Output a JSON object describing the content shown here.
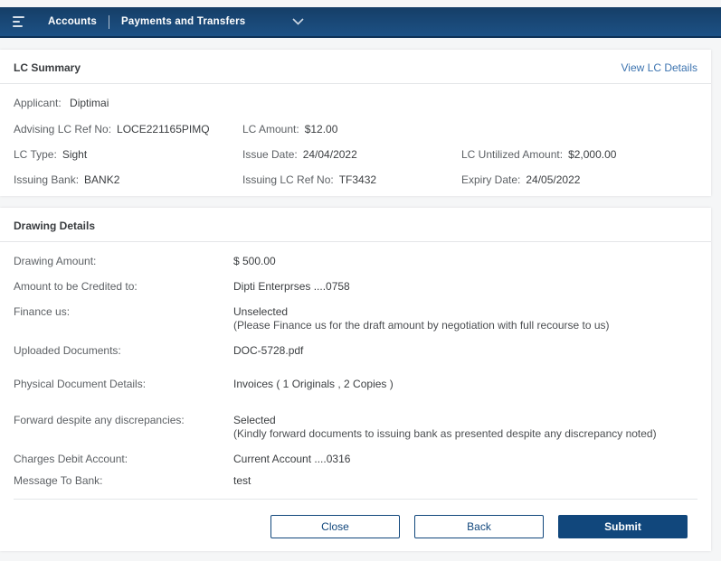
{
  "nav": {
    "accounts_label": "Accounts",
    "payments_label": "Payments and Transfers"
  },
  "lc_summary": {
    "title": "LC Summary",
    "view_details_label": "View LC Details",
    "applicant": {
      "label": "Applicant:",
      "value": "Diptimai"
    },
    "grid": [
      [
        {
          "label": "Advising LC Ref No:",
          "value": "LOCE221165PIMQ"
        },
        {
          "label": "LC Amount:",
          "value": "$12.00"
        }
      ],
      [
        {
          "label": "LC Type:",
          "value": "Sight"
        },
        {
          "label": "Issue Date:",
          "value": "24/04/2022"
        },
        {
          "label": "LC Untilized Amount:",
          "value": "$2,000.00"
        }
      ],
      [
        {
          "label": "Issuing Bank:",
          "value": "BANK2"
        },
        {
          "label": "Issuing LC Ref No:",
          "value": "TF3432"
        },
        {
          "label": "Expiry Date:",
          "value": "24/05/2022"
        }
      ]
    ]
  },
  "drawing_details": {
    "title": "Drawing Details",
    "rows": [
      {
        "label": "Drawing Amount:",
        "value": "$ 500.00"
      },
      {
        "label": "Amount to be Credited to:",
        "value": "Dipti Enterprses ....0758"
      },
      {
        "label": "Finance us:",
        "value": "Unselected",
        "note": "(Please Finance us for the draft amount by negotiation with full recourse to us)"
      },
      {
        "label": "Uploaded Documents:",
        "value": "DOC-5728.pdf"
      },
      {
        "label": "Physical Document Details:",
        "value": "Invoices ( 1 Originals , 2 Copies )"
      },
      {
        "label": "Forward despite any discrepancies:",
        "value": "Selected",
        "note": "(Kindly forward documents to issuing bank as presented despite any discrepancy noted)"
      },
      {
        "label": "Charges Debit Account:",
        "value": "Current Account ....0316"
      },
      {
        "label": "Message To Bank:",
        "value": "test"
      }
    ]
  },
  "actions": {
    "close": "Close",
    "back": "Back",
    "submit": "Submit"
  },
  "colors": {
    "navbar_gradient_top": "#153e67",
    "navbar_gradient_bottom": "#1d5185",
    "navbar_border_bottom": "#0e3157",
    "accent_navy": "#11477c",
    "link_blue": "#3d74b0",
    "label_gray": "#5d6165",
    "value_gray": "#3b3e41",
    "page_background": "#f5f6f7"
  }
}
